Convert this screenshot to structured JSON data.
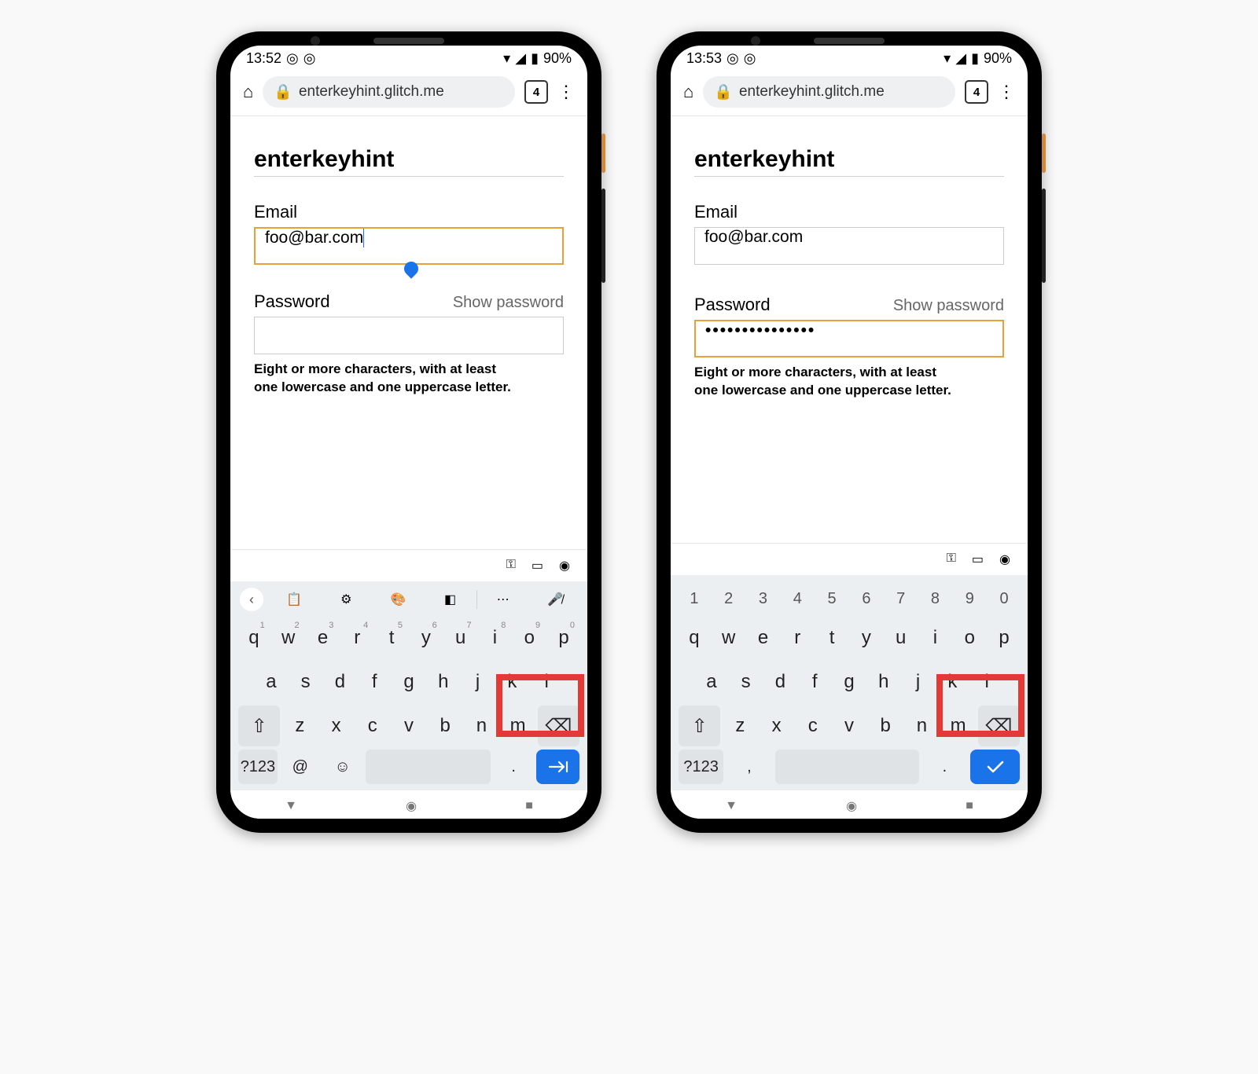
{
  "phones": [
    {
      "status": {
        "time": "13:52",
        "battery": "90%"
      },
      "addr": {
        "url": "enterkeyhint.glitch.me",
        "tabs": "4"
      },
      "page": {
        "title": "enterkeyhint",
        "email_label": "Email",
        "email_value": "foo@bar.com",
        "pw_label": "Password",
        "pw_show": "Show password",
        "pw_value": "",
        "hint1": "Eight or more characters, with at least",
        "hint2": "one lowercase and one uppercase letter.",
        "focused": "email"
      },
      "kbd": {
        "mode": "email",
        "bottom_a": "?123",
        "bottom_b": "@",
        "bottom_c": "☺",
        "bottom_d": ".",
        "enter_icon": "next"
      }
    },
    {
      "status": {
        "time": "13:53",
        "battery": "90%"
      },
      "addr": {
        "url": "enterkeyhint.glitch.me",
        "tabs": "4"
      },
      "page": {
        "title": "enterkeyhint",
        "email_label": "Email",
        "email_value": "foo@bar.com",
        "pw_label": "Password",
        "pw_show": "Show password",
        "pw_value": "•••••••••••••••",
        "hint1": "Eight or more characters, with at least",
        "hint2": "one lowercase and one uppercase letter.",
        "focused": "password"
      },
      "kbd": {
        "mode": "password",
        "bottom_a": "?123",
        "bottom_b": ",",
        "bottom_c": "",
        "bottom_d": ".",
        "enter_icon": "done"
      }
    }
  ],
  "keys": {
    "nums": [
      "1",
      "2",
      "3",
      "4",
      "5",
      "6",
      "7",
      "8",
      "9",
      "0"
    ],
    "row1": [
      "q",
      "w",
      "e",
      "r",
      "t",
      "y",
      "u",
      "i",
      "o",
      "p"
    ],
    "row2": [
      "a",
      "s",
      "d",
      "f",
      "g",
      "h",
      "j",
      "k",
      "l"
    ],
    "row3": [
      "z",
      "x",
      "c",
      "v",
      "b",
      "n",
      "m"
    ]
  }
}
